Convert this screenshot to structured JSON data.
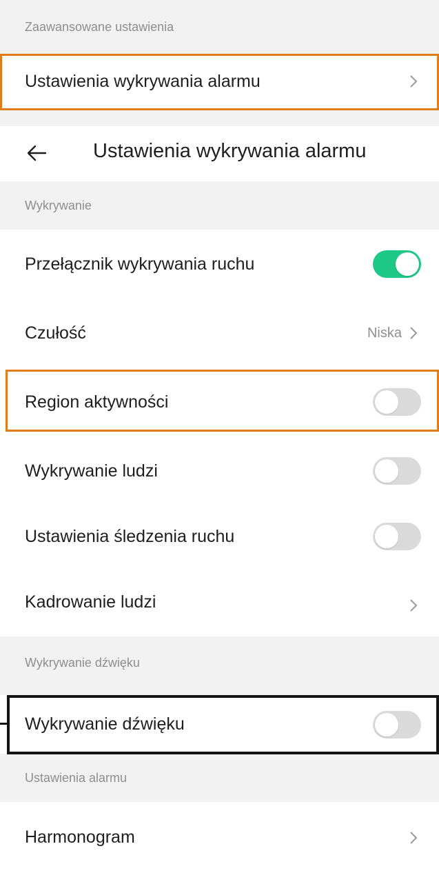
{
  "advanced_section": {
    "header": "Zaawansowane ustawienia",
    "item_label": "Ustawienia wykrywania alarmu"
  },
  "titlebar": {
    "back_icon": "arrow-left-icon",
    "title": "Ustawienia wykrywania alarmu"
  },
  "detection_section": {
    "header": "Wykrywanie",
    "motion_switch": {
      "label": "Przełącznik wykrywania ruchu",
      "enabled": true
    },
    "sensitivity": {
      "label": "Czułość",
      "value": "Niska"
    },
    "activity_region": {
      "label": "Region aktywności",
      "enabled": false
    },
    "human_detection": {
      "label": "Wykrywanie ludzi",
      "enabled": false
    },
    "motion_tracking": {
      "label": "Ustawienia śledzenia ruchu",
      "enabled": false
    },
    "human_framing": {
      "label": "Kadrowanie ludzi"
    }
  },
  "sound_section": {
    "header": "Wykrywanie dźwięku",
    "sound_detection": {
      "label": "Wykrywanie dźwięku",
      "enabled": false
    }
  },
  "alarm_section": {
    "header": "Ustawienia alarmu",
    "schedule": {
      "label": "Harmonogram"
    }
  },
  "colors": {
    "toggle_on": "#1ec887",
    "toggle_off": "#dadada",
    "highlight_orange": "#e07d17",
    "highlight_black": "#141414"
  }
}
